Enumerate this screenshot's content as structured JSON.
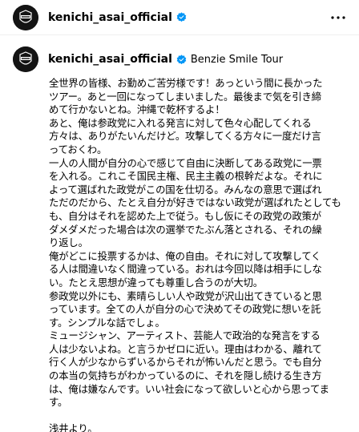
{
  "post": {
    "username": "kenichi_asai_official",
    "avatar_text": "BEZIE\nRECORDS",
    "tour_label": "Benzie Smile Tour"
  },
  "caption_lines": [
    "全世界の皆様、お勤めご苦労様です！あっという間に長かった",
    "ツアー。あと一回になってしまいました。最後まで気を引き締",
    "めて行かないとね。沖縄で乾杯するよ！",
    "あと、俺は参政党に入れる発言に対して色々心配してくれる",
    "方々は、ありがたいんだけど。攻撃してくる方々に一度だけ言",
    "っておくわ。",
    "一人の人間が自分の心で感じて自由に決断してある政党に一票",
    "を入れる。これこそ国民主権、民主主義の根幹だよな。それに",
    "よって選ばれた政党がこの国を仕切る。みんなの意思で選ばれ",
    "ただのだから、たとえ自分が好きではない政党が選ばれたとしても",
    "も、自分はそれを認めた上で従う。もし仮にその政党の政策が",
    "ダメダメだった場合は次の選挙でたぶん落とされる、それの繰",
    "り返し。",
    "俺がどこに投票するかは、俺の自由。それに対して攻撃してく",
    "る人は間違いなく間違っている。おれは今回以降は相手にしな",
    "い。たとえ思想が違っても尊重し合うのが大切。",
    "参政党以外にも、素晴らしい人や政党が沢山出てきていると思",
    "っています。全ての人が自分の心で決めてその政党に想いを託",
    "す。シンプルな話でしょ。",
    "ミュージシャン、アーティスト、芸能人で政治的な発言をする",
    "人は少ないよね。と言うかゼロに近い。理由はわかる、離れて",
    "行く人が少なからずいるからそれが怖いんだと思う。でも自分",
    "の本当の気持ちがわかっているのに、それを隠し続ける生き方",
    "は、俺は嫌なんです。いい社会になって欲しいと心から思ってま",
    "す。",
    "",
    "浅井より。"
  ],
  "colors": {
    "verified": "#0095f6",
    "text": "#000000",
    "avatar_bg": "#141414"
  },
  "icons": {
    "verified": "verified-badge-icon",
    "more": "more-options-icon"
  }
}
